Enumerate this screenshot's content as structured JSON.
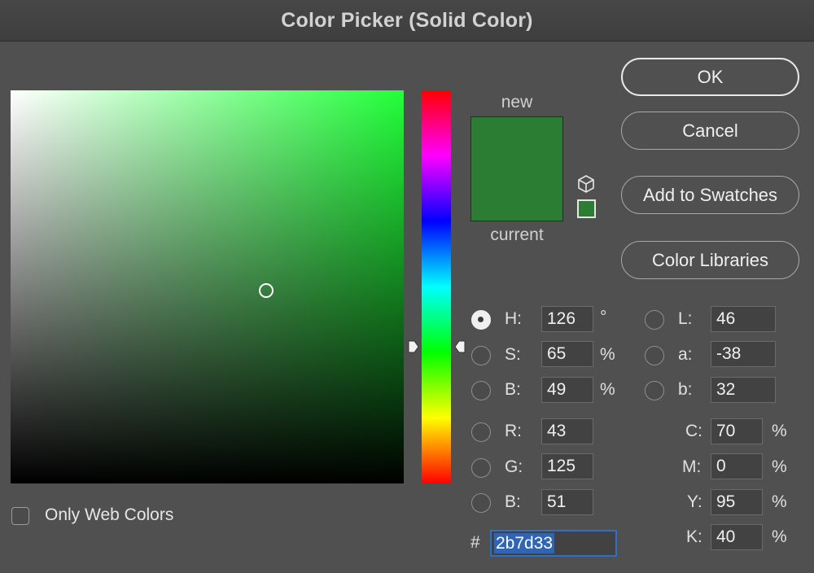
{
  "window": {
    "title": "Color Picker (Solid Color)"
  },
  "colors": {
    "new": "#2b7d33",
    "current": "#2b7d33",
    "hue_base": "#22ff3a"
  },
  "swatches": {
    "new_label": "new",
    "current_label": "current"
  },
  "buttons": {
    "ok": "OK",
    "cancel": "Cancel",
    "add_to_swatches": "Add to Swatches",
    "color_libraries": "Color Libraries"
  },
  "hsb": {
    "h": {
      "label": "H:",
      "value": "126",
      "unit": "°"
    },
    "s": {
      "label": "S:",
      "value": "65",
      "unit": "%"
    },
    "b": {
      "label": "B:",
      "value": "49",
      "unit": "%"
    }
  },
  "rgb": {
    "r": {
      "label": "R:",
      "value": "43"
    },
    "g": {
      "label": "G:",
      "value": "125"
    },
    "b": {
      "label": "B:",
      "value": "51"
    }
  },
  "lab": {
    "l": {
      "label": "L:",
      "value": "46"
    },
    "a": {
      "label": "a:",
      "value": "-38"
    },
    "b": {
      "label": "b:",
      "value": "32"
    }
  },
  "cmyk": {
    "c": {
      "label": "C:",
      "value": "70",
      "unit": "%"
    },
    "m": {
      "label": "M:",
      "value": "0",
      "unit": "%"
    },
    "y": {
      "label": "Y:",
      "value": "95",
      "unit": "%"
    },
    "k": {
      "label": "K:",
      "value": "40",
      "unit": "%"
    }
  },
  "hex": {
    "label": "#",
    "value": "2b7d33"
  },
  "web_colors": {
    "label": "Only Web Colors",
    "checked": false
  },
  "selected_mode": "H",
  "icons": {
    "gamut": "cube-icon",
    "websafe": "websafe-swatch"
  }
}
